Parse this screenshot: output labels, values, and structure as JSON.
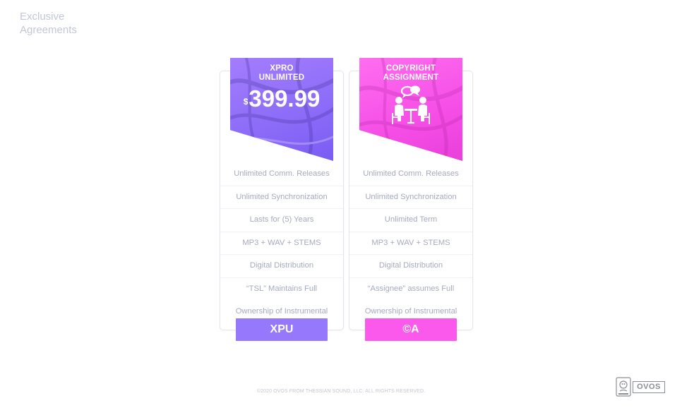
{
  "page": {
    "heading": "Exclusive\nAgreements"
  },
  "plans": [
    {
      "title": "XPRO\nUNLIMITED",
      "price_currency": "$",
      "price_value": "399.99",
      "features": [
        "Unlimited Comm. Releases",
        "Unlimited Synchronization",
        "Lasts for (5) Years",
        "MP3 + WAV + STEMS",
        "Digital Distribution",
        "“TSL” Maintains Full",
        "Ownership of Instrumental"
      ],
      "button_label": "XPU",
      "accent_color": "#9578fc"
    },
    {
      "title": "COPYRIGHT\nASSIGNMENT",
      "icon": "meeting-icon",
      "features": [
        "Unlimited Comm. Releases",
        "Unlimited Synchronization",
        "Unlimited Term",
        "MP3 + WAV + STEMS",
        "Digital Distribution",
        "“Assignee” assumes Full",
        "Ownership of Instrumental"
      ],
      "button_label": "©A",
      "accent_color": "#fb59ec"
    }
  ],
  "footer": {
    "copyright": "©2020 OVOS FROM THESSIAN SOUND, LLC. ALL RIGHTS RESERVED."
  },
  "logo": {
    "badge_icon": "ovos-badge-icon",
    "wordmark": "OVOS"
  }
}
